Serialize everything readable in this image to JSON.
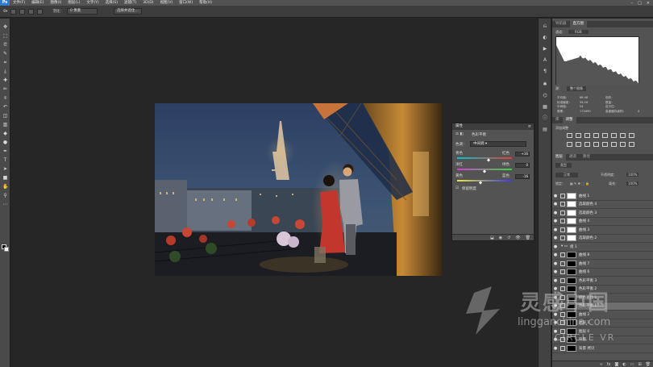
{
  "app": {
    "logo": "Ps"
  },
  "menubar": {
    "items": [
      "文件(F)",
      "编辑(E)",
      "图像(I)",
      "图层(L)",
      "文字(Y)",
      "选择(S)",
      "滤镜(T)",
      "3D(D)",
      "视图(V)",
      "窗口(W)",
      "帮助(H)"
    ],
    "window_controls": [
      "–",
      "□",
      "×"
    ]
  },
  "optionsbar": {
    "feather_label": "羽化：",
    "feather_value": "0 像素",
    "select_mask_button": "选择并遮住..."
  },
  "toolbar": {
    "tools": [
      "move-icon",
      "marquee-icon",
      "lasso-icon",
      "quick-select-icon",
      "crop-icon",
      "eyedropper-icon",
      "healing-icon",
      "brush-icon",
      "stamp-icon",
      "history-brush-icon",
      "eraser-icon",
      "gradient-icon",
      "blur-icon",
      "dodge-icon",
      "pen-icon",
      "type-icon",
      "path-select-icon",
      "shape-icon",
      "hand-icon",
      "zoom-icon",
      "more-icon"
    ]
  },
  "properties": {
    "title": "属性",
    "panel_name": "色彩平衡",
    "tone_label": "色调：",
    "tone_value": "中间调",
    "sliders": [
      {
        "left": "青色",
        "right": "红色",
        "value": "+16",
        "fraction": 0.58,
        "color_left": "#00c6c6",
        "color_right": "#e83a3a"
      },
      {
        "left": "洋红",
        "right": "绿色",
        "value": "0",
        "fraction": 0.5,
        "color_left": "#d63ad6",
        "color_right": "#3ad63a"
      },
      {
        "left": "黄色",
        "right": "蓝色",
        "value": "-16",
        "fraction": 0.42,
        "color_left": "#e8e83a",
        "color_right": "#3a3ae8"
      }
    ],
    "preserve_luminosity": "保留明度"
  },
  "histogram_panel": {
    "tabs": [
      "导航器",
      "直方图"
    ],
    "channel_label": "通道：",
    "channel_value": "RGB",
    "source_label": "源：",
    "source_value": "整个图像",
    "stats_left": [
      "平均值：",
      "标准偏差：",
      "中间值：",
      "像素："
    ],
    "stats_left_values": [
      "68.48",
      "56.16",
      "54",
      "170490"
    ],
    "stats_right": [
      "色阶：",
      "数量：",
      "百分位：",
      "高速缓存级别："
    ],
    "stats_right_values": [
      "",
      "",
      "",
      "4"
    ]
  },
  "adjustments_panel": {
    "tabs": [
      "库",
      "调整"
    ],
    "add_label": "添加调整"
  },
  "layers_panel": {
    "tabs": [
      "图层",
      "通道",
      "路径"
    ],
    "kind_label": "类型",
    "blend_mode": "正常",
    "opacity_label": "不透明度：",
    "opacity_value": "100%",
    "lock_label": "锁定：",
    "fill_label": "填充：",
    "fill_value": "100%",
    "layers": [
      {
        "name": "曲线 1",
        "type": "adj",
        "visible": true
      },
      {
        "name": "选取颜色 4",
        "type": "adj",
        "visible": true
      },
      {
        "name": "选取颜色 3",
        "type": "adj",
        "visible": true
      },
      {
        "name": "曲线 4",
        "type": "adj",
        "visible": true
      },
      {
        "name": "曲线 3",
        "type": "adj",
        "visible": true
      },
      {
        "name": "选取颜色 2",
        "type": "adj",
        "visible": true
      },
      {
        "name": "组 1",
        "type": "group",
        "visible": true
      },
      {
        "name": "曲线 8",
        "type": "mask",
        "visible": true
      },
      {
        "name": "曲线 7",
        "type": "mask",
        "visible": true
      },
      {
        "name": "曲线 6",
        "type": "mask",
        "visible": true
      },
      {
        "name": "色彩平衡 3",
        "type": "mask",
        "visible": true
      },
      {
        "name": "色彩平衡 2",
        "type": "mask",
        "visible": true
      },
      {
        "name": "颜色查找 1",
        "type": "mask",
        "visible": true
      },
      {
        "name": "色彩平衡 1",
        "type": "mask",
        "visible": true,
        "selected": true
      },
      {
        "name": "曲线 2",
        "type": "mask",
        "visible": true
      },
      {
        "name": "图层 1",
        "type": "mask",
        "visible": true
      },
      {
        "name": "图层 0",
        "type": "mask",
        "visible": true
      },
      {
        "name": "背景",
        "type": "mask",
        "visible": true
      },
      {
        "name": "背景 拷贝",
        "type": "mask",
        "visible": true
      }
    ]
  },
  "watermark": {
    "brand": "灵感中国",
    "url": "lingganchina.com",
    "sub": "CIRCLE VR"
  }
}
